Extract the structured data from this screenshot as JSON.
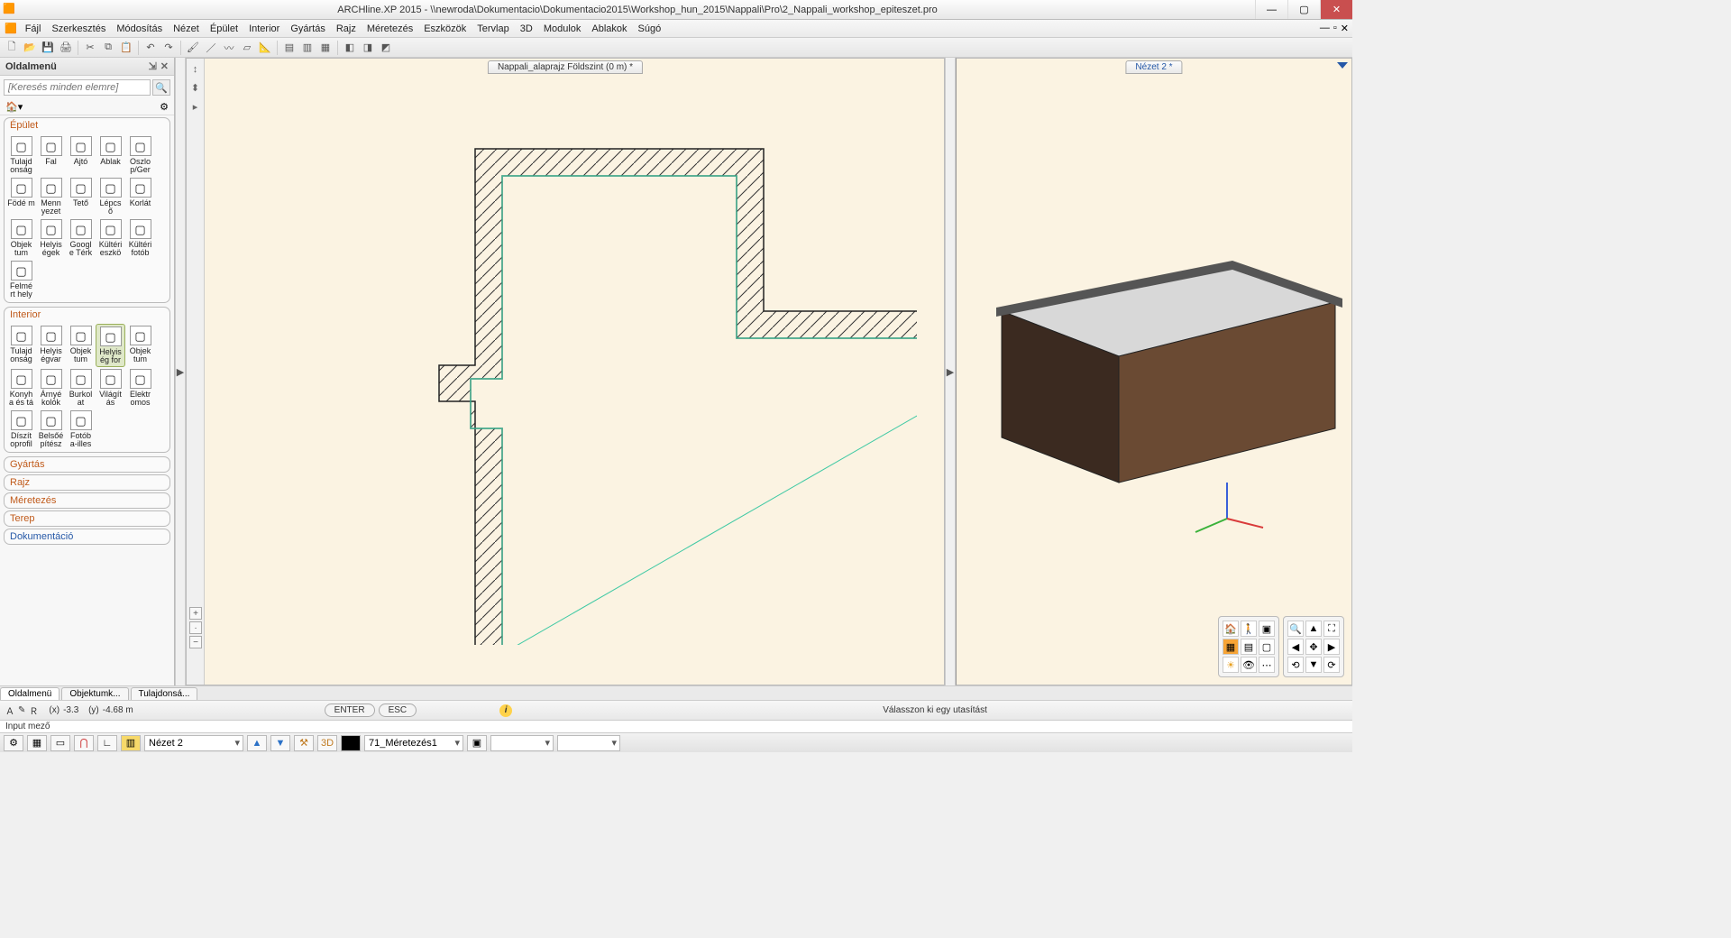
{
  "title": "ARCHline.XP 2015 - \\\\newroda\\Dokumentacio\\Dokumentacio2015\\Workshop_hun_2015\\Nappali\\Pro\\2_Nappali_workshop_epiteszet.pro",
  "menu": [
    "Fájl",
    "Szerkesztés",
    "Módosítás",
    "Nézet",
    "Épület",
    "Interior",
    "Gyártás",
    "Rajz",
    "Méretezés",
    "Eszközök",
    "Tervlap",
    "3D",
    "Modulok",
    "Ablakok",
    "Súgó"
  ],
  "sidemenu_title": "Oldalmenü",
  "search_placeholder": "[Keresés minden elemre]",
  "cat_epulet": "Épület",
  "cat_interior": "Interior",
  "cat_gyartas": "Gyártás",
  "cat_rajz": "Rajz",
  "cat_meretezes": "Méretezés",
  "cat_terep": "Terep",
  "cat_dokumentacio": "Dokumentáció",
  "epulet_items": [
    {
      "l": "Tulajd onság"
    },
    {
      "l": "Fal"
    },
    {
      "l": "Ajtó"
    },
    {
      "l": "Ablak"
    },
    {
      "l": "Oszlo p/Ger"
    },
    {
      "l": "Födé m"
    },
    {
      "l": "Menn yezet"
    },
    {
      "l": "Tető"
    },
    {
      "l": "Lépcs ő"
    },
    {
      "l": "Korlát"
    },
    {
      "l": "Objek tum"
    },
    {
      "l": "Helyis égek"
    },
    {
      "l": "Googl e Térk"
    },
    {
      "l": "Kültéri eszkö"
    },
    {
      "l": "Kültéri fotób"
    },
    {
      "l": "Felmé rt hely"
    }
  ],
  "interior_items": [
    {
      "l": "Tulajd onság"
    },
    {
      "l": "Helyis égvar"
    },
    {
      "l": "Objek tum"
    },
    {
      "l": "Helyis ég for",
      "sel": true
    },
    {
      "l": "Objek tum"
    },
    {
      "l": "Konyh a és tá"
    },
    {
      "l": "Árnyé kolók"
    },
    {
      "l": "Burkol at"
    },
    {
      "l": "Világít ás"
    },
    {
      "l": "Elektr omos"
    },
    {
      "l": "Díszít oprofil"
    },
    {
      "l": "Belsőé pítész"
    },
    {
      "l": "Fotób a-illes"
    }
  ],
  "view2d_tab": "Nappali_alaprajz Földszint (0 m) *",
  "view3d_tab": "Nézet 2 *",
  "tabs": [
    "Oldalmenü",
    "Objektumk...",
    "Tulajdonsá..."
  ],
  "status": {
    "coords_x_label": "(x)",
    "coords_x": "-3.3",
    "coords_y_label": "(y)",
    "coords_y": "-4.68 m",
    "enter": "ENTER",
    "esc": "ESC",
    "hint": "Válasszon ki egy utasítást"
  },
  "input_label": "Input mező",
  "bottom": {
    "view": "Nézet 2",
    "layer": "71_Méretezés1"
  }
}
